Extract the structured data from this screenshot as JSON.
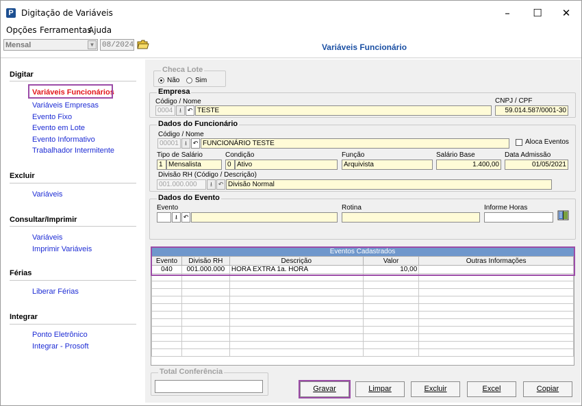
{
  "window": {
    "title": "Digitação de Variáveis",
    "logo": "P",
    "controls": {
      "minimize": "–",
      "maximize": "☐",
      "close": "✕"
    }
  },
  "menubar": [
    "Opções",
    "Ferramentas",
    "Ajuda"
  ],
  "toolbar": {
    "period_value": "Mensal",
    "date_value": "08/2024",
    "panel_title": "Variáveis Funcionário"
  },
  "sidebar": {
    "sections": [
      {
        "title": "Digitar",
        "items": [
          "Variáveis Funcionários",
          "Variáveis Empresas",
          "Evento Fixo",
          "Evento em Lote",
          "Evento Informativo",
          "Trabalhador Intermitente"
        ]
      },
      {
        "title": "Excluir",
        "items": [
          "Variáveis"
        ]
      },
      {
        "title": "Consultar/Imprimir",
        "items": [
          "Variáveis",
          "Imprimir Variáveis"
        ]
      },
      {
        "title": "Férias",
        "items": [
          "Liberar Férias"
        ]
      },
      {
        "title": "Integrar",
        "items": [
          "Ponto Eletrônico",
          "Integrar - Prosoft"
        ]
      }
    ],
    "active_item": "Variáveis Funcionários"
  },
  "checa_lote": {
    "title": "Checa Lote",
    "option_no": "Não",
    "option_yes": "Sim",
    "selected": "Não"
  },
  "empresa": {
    "title": "Empresa",
    "code_label": "Código / Nome",
    "code": "0004",
    "name": "TESTE",
    "cnpj_label": "CNPJ / CPF",
    "cnpj": "59.014.587/0001-30"
  },
  "funcionario": {
    "title": "Dados do Funcionário",
    "code_label": "Código / Nome",
    "code": "00001",
    "name": "FUNCIONÁRIO TESTE",
    "aloca_label": "Aloca Eventos",
    "tipo_label": "Tipo de Salário",
    "tipo_code": "1",
    "tipo_desc": "Mensalista",
    "cond_label": "Condição",
    "cond_code": "0",
    "cond_desc": "Ativo",
    "funcao_label": "Função",
    "funcao": "Arquivista",
    "salario_label": "Salário Base",
    "salario": "1.400,00",
    "admissao_label": "Data Admissão",
    "admissao": "01/05/2021",
    "divisao_label": "Divisão RH (Código / Descrição)",
    "divisao_code": "001.000.000",
    "divisao_desc": "Divisão Normal"
  },
  "evento": {
    "title": "Dados do Evento",
    "evento_label": "Evento",
    "rotina_label": "Rotina",
    "horas_label": "Informe Horas"
  },
  "grid": {
    "caption": "Eventos Cadastrados",
    "columns": [
      "Evento",
      "Divisão RH",
      "Descrição",
      "Valor",
      "Outras Informações"
    ],
    "rows": [
      [
        "040",
        "001.000.000",
        "HORA EXTRA 1a. HORA",
        "10,00",
        ""
      ]
    ]
  },
  "total": {
    "title": "Total Conferência",
    "value": ""
  },
  "buttons": [
    "Gravar",
    "Limpar",
    "Excluir",
    "Excel",
    "Copiar"
  ],
  "colors": {
    "link": "#1c2bd4",
    "active_link": "#e3151a",
    "highlight": "#9b4ba7",
    "header_blue": "#1a4fa3",
    "grid_caption": "#6f97cc",
    "input_bg": "#fffbd7"
  }
}
